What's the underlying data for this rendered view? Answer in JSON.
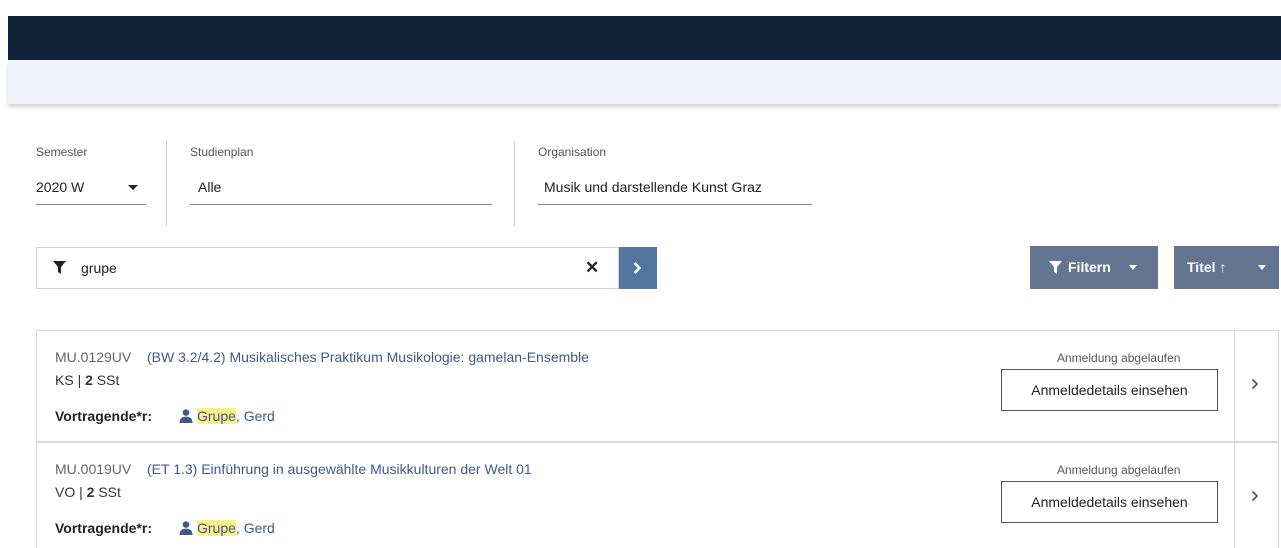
{
  "header": {
    "bg_color": "#0f2238",
    "subbar_color": "#eef1f7"
  },
  "filters": {
    "semester": {
      "label": "Semester",
      "value": "2020 W"
    },
    "studienplan": {
      "label": "Studienplan",
      "value": "Alle"
    },
    "organisation": {
      "label": "Organisation",
      "value": "Musik und darstellende Kunst Graz"
    }
  },
  "search": {
    "value": "grupe",
    "clear_icon": "close-icon",
    "submit_icon": "chevron-right-icon"
  },
  "toolbar": {
    "filter_label": "Filtern",
    "sort_label": "Titel ↑",
    "accent": "#647591"
  },
  "courses": [
    {
      "code": "MU.0129UV",
      "title": "(BW 3.2/4.2) Musikalisches Praktikum Musikologie: gamelan-Ensemble",
      "type": "KS",
      "sst_value": "2",
      "sst_unit": "SSt",
      "lecturer_label": "Vortragende*r:",
      "lecturer_highlight": "Grupe",
      "lecturer_rest": ", Gerd",
      "status": "Anmeldung abgelaufen",
      "details_label": "Anmeldedetails einsehen"
    },
    {
      "code": "MU.0019UV",
      "title": "(ET 1.3) Einführung in ausgewählte Musikkulturen der Welt 01",
      "type": "VO",
      "sst_value": "2",
      "sst_unit": "SSt",
      "lecturer_label": "Vortragende*r:",
      "lecturer_highlight": "Grupe",
      "lecturer_rest": ", Gerd",
      "status": "Anmeldung abgelaufen",
      "details_label": "Anmeldedetails einsehen"
    }
  ]
}
